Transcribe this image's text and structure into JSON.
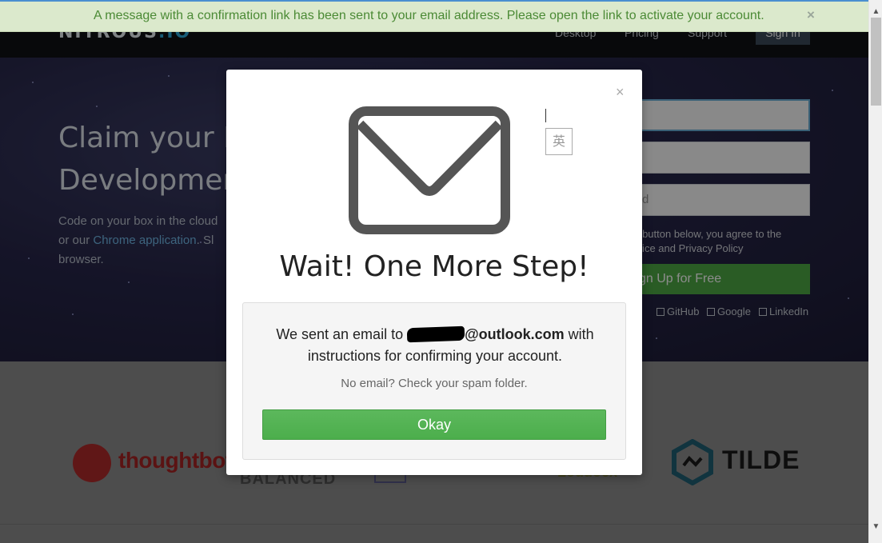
{
  "notification": {
    "message": "A message with a confirmation link has been sent to your email address. Please open the link to activate your account.",
    "close_symbol": "×"
  },
  "header": {
    "logo_main": "NITROUS",
    "logo_suffix": ".IO",
    "nav": [
      "Desktop",
      "Pricing",
      "Support"
    ],
    "signin_label": "Sign In"
  },
  "hero": {
    "title_line1": "Claim your  N",
    "title_line2": "Development",
    "text_part1": "Code on your box in the cloud",
    "text_part2": "or our ",
    "chrome_link": "Chrome application",
    "text_part3": ". Sl",
    "text_part4": "browser.",
    "password_placeholder": "rd",
    "terms_line1": "up button below, you agree to the",
    "terms_line2": "ervice and Privacy Policy",
    "signup_label": "gn Up for Free",
    "social": [
      "GitHub",
      "Google",
      "LinkedIn"
    ]
  },
  "logos": {
    "thoughtbot": "thoughtbot",
    "balanced": "BALANCED",
    "fragment": "Loudocx",
    "tilde": "TILDE"
  },
  "modal": {
    "close_symbol": "×",
    "ime_indicator": "英",
    "title": "Wait! One More Step!",
    "sent_prefix": "We sent an email to ",
    "email_domain": "@outlook.com",
    "sent_suffix": " with instructions for confirming your account.",
    "spam_note": "No email? Check your spam folder.",
    "okay_label": "Okay"
  },
  "colors": {
    "notice_bg": "#dbe9cc",
    "notice_text": "#4b8a35",
    "okay_button": "#5cb85c",
    "signup_button": "#4ea844"
  }
}
